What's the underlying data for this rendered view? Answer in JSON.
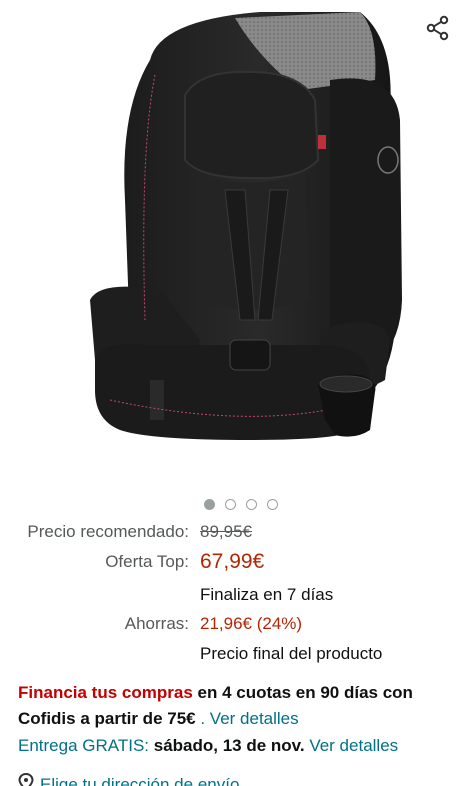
{
  "image": {
    "alt": "product-car-seat"
  },
  "carousel": {
    "count": 4,
    "active": 0
  },
  "pricing": {
    "recommended_label": "Precio recomendado:",
    "recommended_value": "89,95€",
    "offer_label": "Oferta Top:",
    "offer_value": "67,99€",
    "ends_text": "Finaliza en 7 días",
    "savings_label": "Ahorras:",
    "savings_value": "21,96€ (24%)",
    "final_text": "Precio final del producto"
  },
  "financing": {
    "link_text": "Financia tus compras",
    "text1": " en 4 cuotas en 90 días con Cofidis a partir de 75€",
    "separator": " . ",
    "details_link": "Ver detalles"
  },
  "delivery": {
    "label": "Entrega GRATIS:",
    "date": " sábado, 13 de nov.",
    "details_link": " Ver detalles"
  },
  "address": {
    "link_text": "Elige tu dirección de envío"
  },
  "colors": {
    "price_red": "#b12704",
    "link_teal": "#007185",
    "finance_red": "#c40000"
  }
}
